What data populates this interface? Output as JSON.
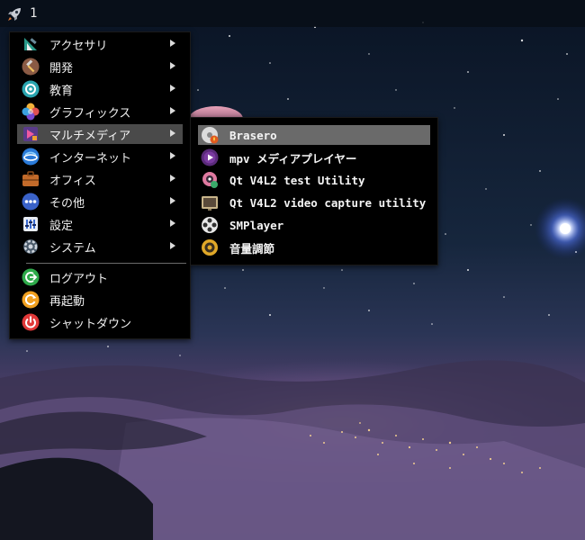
{
  "panel": {
    "workspace": "1",
    "launcher_icon": "rocket-icon"
  },
  "main_menu": {
    "items": [
      {
        "label": "アクセサリ",
        "icon": "accessories-icon",
        "submenu": true
      },
      {
        "label": "開発",
        "icon": "development-icon",
        "submenu": true
      },
      {
        "label": "教育",
        "icon": "education-icon",
        "submenu": true
      },
      {
        "label": "グラフィックス",
        "icon": "graphics-icon",
        "submenu": true
      },
      {
        "label": "マルチメディア",
        "icon": "multimedia-icon",
        "submenu": true,
        "selected": true
      },
      {
        "label": "インターネット",
        "icon": "internet-icon",
        "submenu": true
      },
      {
        "label": "オフィス",
        "icon": "office-icon",
        "submenu": true
      },
      {
        "label": "その他",
        "icon": "other-icon",
        "submenu": true
      },
      {
        "label": "設定",
        "icon": "settings-icon",
        "submenu": true
      },
      {
        "label": "システム",
        "icon": "system-icon",
        "submenu": true
      }
    ],
    "session": [
      {
        "label": "ログアウト",
        "icon": "logout-icon"
      },
      {
        "label": "再起動",
        "icon": "reboot-icon"
      },
      {
        "label": "シャットダウン",
        "icon": "shutdown-icon"
      }
    ]
  },
  "sub_menu": {
    "items": [
      {
        "label": "Brasero",
        "icon": "brasero-icon",
        "selected": true
      },
      {
        "label": "mpv メディアプレイヤー",
        "icon": "mpv-icon"
      },
      {
        "label": "Qt V4L2 test Utility",
        "icon": "qv4l2-icon"
      },
      {
        "label": "Qt V4L2 video capture utility",
        "icon": "qvidcap-icon"
      },
      {
        "label": "SMPlayer",
        "icon": "smplayer-icon"
      },
      {
        "label": "音量調節",
        "icon": "volume-control-icon"
      }
    ]
  },
  "colors": {
    "menu_bg": "#000000",
    "highlight": "#4a4a4a",
    "submenu_highlight": "#6a6a6a",
    "text": "#f0f0f0"
  }
}
